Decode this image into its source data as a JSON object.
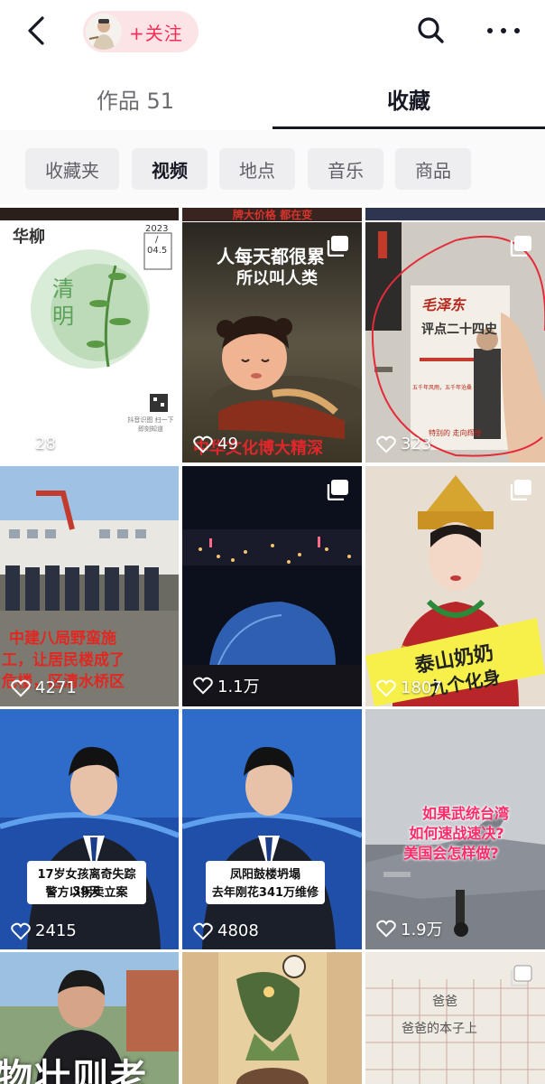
{
  "header": {
    "follow_label": "+关注",
    "icons": {
      "back": "chevron-left-icon",
      "search": "search-icon",
      "more": "more-dots-icon"
    }
  },
  "tabs": {
    "works": "作品 51",
    "favorites": "收藏"
  },
  "filters": [
    "收藏夹",
    "视频",
    "地点",
    "音乐",
    "商品"
  ],
  "active_filter": "视频",
  "tiles": [
    {
      "likes": "28",
      "text": {
        "t1": "华柳",
        "t2": "清",
        "t3": "明",
        "date_year": "2023",
        "date_sep": "/",
        "date_day": "04.5",
        "qr_note": "抖音识图 扫一下即刻知道"
      }
    },
    {
      "likes": "49",
      "text": {
        "t1": "人每天都很累",
        "t2": "所以叫人类",
        "t3": "中华文化博大精深"
      }
    },
    {
      "likes": "323",
      "text": {
        "t1": "毛泽东",
        "t2": "评点二十四史",
        "t3": "五千年风雨，五千年沧桑",
        "t4": "特别的 走向辉煌"
      }
    },
    {
      "likes": "4271",
      "text": {
        "t1": "中建八局野蛮施",
        "t2": "工，让居民楼成了",
        "t3": "危楼，区清水桥区"
      }
    },
    {
      "likes": "1.1万",
      "text": {}
    },
    {
      "likes": "1807",
      "text": {
        "t1": "泰山奶奶",
        "t2": "九个化身"
      }
    },
    {
      "likes": "2415",
      "text": {
        "t1": "17岁女孩离奇失踪39天",
        "t2": "警方以拐卖立案"
      }
    },
    {
      "likes": "4808",
      "text": {
        "t1": "凤阳鼓楼坍塌",
        "t2": "去年刚花341万维修"
      }
    },
    {
      "likes": "1.9万",
      "text": {
        "t1": "如果武统台湾",
        "t2": "如何速战速决?",
        "t3": "美国会怎样做?"
      }
    },
    {
      "likes": "",
      "text": {
        "t1": "物壮则老"
      }
    },
    {
      "likes": "",
      "text": {}
    },
    {
      "likes": "",
      "text": {
        "t1": "爸爸",
        "t2": "爸爸的本子上"
      }
    }
  ],
  "colors": {
    "accent": "#fe2c55",
    "annotation_red": "#e52b3a",
    "text_primary": "#161823",
    "text_secondary": "#6b6c72"
  }
}
